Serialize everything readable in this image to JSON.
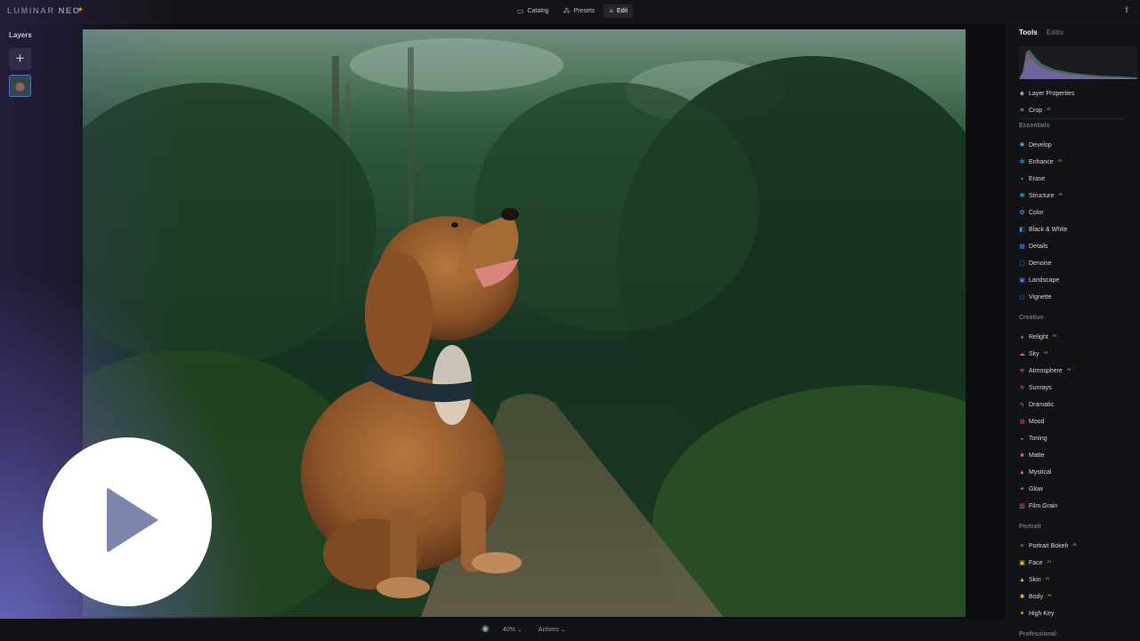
{
  "app": {
    "logo_main": "LUMINAR",
    "logo_sub": "NEO"
  },
  "topnav": [
    {
      "label": "Catalog",
      "icon": "folder-icon"
    },
    {
      "label": "Presets",
      "icon": "presets-icon"
    },
    {
      "label": "Edit",
      "icon": "sliders-icon",
      "active": true
    }
  ],
  "layers": {
    "title": "Layers",
    "add_symbol": "+"
  },
  "bottom": {
    "zoom": "40%",
    "zoom_caret": "⌄",
    "actions": "Actions",
    "actions_caret": "⌄"
  },
  "right": {
    "tabs": {
      "tools": "Tools",
      "edits": "Edits"
    },
    "top_tools": [
      {
        "label": "Layer Properties",
        "icon": "layers-icon",
        "color": "#cfd2d8",
        "ai": false
      },
      {
        "label": "Crop",
        "icon": "crop-icon",
        "color": "#cfd2d8",
        "ai": true
      }
    ],
    "sections": [
      {
        "title": "Essentials",
        "tools": [
          {
            "label": "Develop",
            "icon": "develop-icon",
            "color": "#3fb5f0",
            "ai": false
          },
          {
            "label": "Enhance",
            "icon": "enhance-icon",
            "color": "#3fb5f0",
            "ai": true
          },
          {
            "label": "Erase",
            "icon": "erase-icon",
            "color": "#3fb5f0",
            "ai": false
          },
          {
            "label": "Structure",
            "icon": "structure-icon",
            "color": "#3fb5f0",
            "ai": true
          },
          {
            "label": "Color",
            "icon": "color-icon",
            "color": "#3f8df0",
            "ai": false
          },
          {
            "label": "Black & White",
            "icon": "bw-icon",
            "color": "#3f8df0",
            "ai": false
          },
          {
            "label": "Details",
            "icon": "details-icon",
            "color": "#3f7df0",
            "ai": false
          },
          {
            "label": "Denoise",
            "icon": "denoise-icon",
            "color": "#3f7df0",
            "ai": false
          },
          {
            "label": "Landscape",
            "icon": "landscape-icon",
            "color": "#3f7df0",
            "ai": false
          },
          {
            "label": "Vignette",
            "icon": "vignette-icon",
            "color": "#3f7df0",
            "ai": false
          }
        ]
      },
      {
        "title": "Creative",
        "tools": [
          {
            "label": "Relight",
            "icon": "relight-icon",
            "color": "#f0508a",
            "ai": true
          },
          {
            "label": "Sky",
            "icon": "sky-icon",
            "color": "#f0508a",
            "ai": true
          },
          {
            "label": "Atmosphere",
            "icon": "atmosphere-icon",
            "color": "#f0508a",
            "ai": true
          },
          {
            "label": "Sunrays",
            "icon": "sunrays-icon",
            "color": "#f0508a",
            "ai": false
          },
          {
            "label": "Dramatic",
            "icon": "dramatic-icon",
            "color": "#f0508a",
            "ai": false
          },
          {
            "label": "Mood",
            "icon": "mood-icon",
            "color": "#f0508a",
            "ai": false
          },
          {
            "label": "Toning",
            "icon": "toning-icon",
            "color": "#f0508a",
            "ai": false
          },
          {
            "label": "Matte",
            "icon": "matte-icon",
            "color": "#f0508a",
            "ai": false
          },
          {
            "label": "Mystical",
            "icon": "mystical-icon",
            "color": "#f0508a",
            "ai": false
          },
          {
            "label": "Glow",
            "icon": "glow-icon",
            "color": "#f0508a",
            "ai": false
          },
          {
            "label": "Film Grain",
            "icon": "film-grain-icon",
            "color": "#f0508a",
            "ai": false
          }
        ]
      },
      {
        "title": "Portrait",
        "tools": [
          {
            "label": "Portrait Bokeh",
            "icon": "bokeh-icon",
            "color": "#f0b030",
            "ai": true
          },
          {
            "label": "Face",
            "icon": "face-icon",
            "color": "#f0b030",
            "ai": true
          },
          {
            "label": "Skin",
            "icon": "skin-icon",
            "color": "#f0b030",
            "ai": true
          },
          {
            "label": "Body",
            "icon": "body-icon",
            "color": "#f0b030",
            "ai": true
          },
          {
            "label": "High Key",
            "icon": "high-key-icon",
            "color": "#f0b030",
            "ai": false
          }
        ]
      },
      {
        "title": "Professional",
        "tools": []
      }
    ],
    "ai_badge": "AI"
  },
  "colors": {
    "accent": "#3f8df0",
    "creative": "#f0508a",
    "portrait": "#f0b030"
  }
}
